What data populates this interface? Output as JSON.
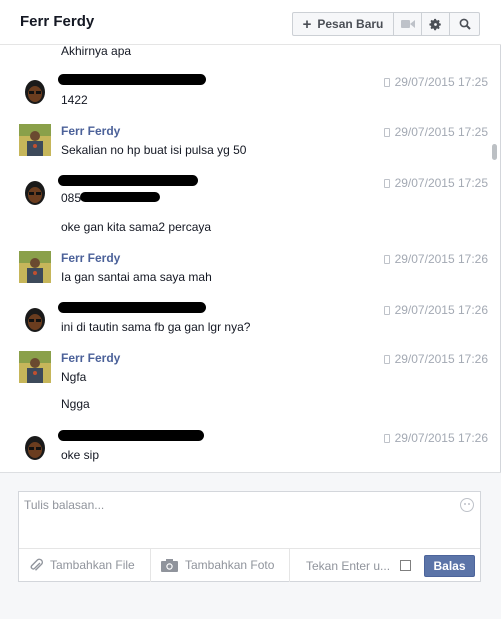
{
  "header": {
    "title": "Ferr Ferdy",
    "new_message_label": "Pesan Baru"
  },
  "thread": {
    "cut_line": "Akhirnya apa",
    "messages": [
      {
        "sender": "",
        "lines": [
          "1422"
        ],
        "time": "29/07/2015 17:25"
      },
      {
        "sender": "Ferr Ferdy",
        "lines": [
          "Sekalian no hp buat isi pulsa yg 50"
        ],
        "time": "29/07/2015 17:25"
      },
      {
        "sender": "",
        "lines": [
          "085",
          "oke gan kita sama2 percaya"
        ],
        "time": "29/07/2015 17:25"
      },
      {
        "sender": "Ferr Ferdy",
        "lines": [
          "Ia gan santai ama saya mah"
        ],
        "time": "29/07/2015 17:26"
      },
      {
        "sender": "",
        "lines": [
          "ini di tautin sama fb ga gan lgr nya?"
        ],
        "time": "29/07/2015 17:26"
      },
      {
        "sender": "Ferr Ferdy",
        "lines": [
          "Ngfa",
          "Ngga"
        ],
        "time": "29/07/2015 17:26"
      },
      {
        "sender": "",
        "lines": [
          "oke sip"
        ],
        "time": "29/07/2015 17:26"
      }
    ]
  },
  "composer": {
    "placeholder": "Tulis balasan...",
    "add_file": "Tambahkan File",
    "add_photo": "Tambahkan Foto",
    "enter_label": "Tekan Enter u...",
    "send_label": "Balas"
  },
  "colors": {
    "sender_name": "#4b6199",
    "timestamp": "#a3a9b3",
    "send_button": "#5b74a8"
  },
  "icons": [
    "plus-icon",
    "video-icon",
    "gear-icon",
    "search-icon",
    "phone-icon",
    "paperclip-icon",
    "camera-icon",
    "emoji-icon"
  ]
}
